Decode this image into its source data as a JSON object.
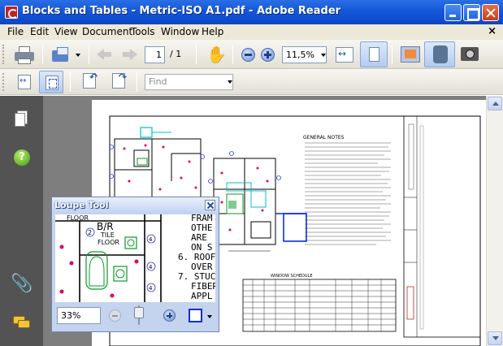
{
  "window": {
    "title": "Blocks and Tables - Metric-ISO A1.pdf - Adobe Reader"
  },
  "menu": {
    "items": [
      "File",
      "Edit",
      "View",
      "Document",
      "Tools",
      "Window",
      "Help"
    ],
    "close_doc": "×"
  },
  "toolbar": {
    "page_current": "1",
    "page_total": "/ 1",
    "zoom": "11,5%",
    "find_placeholder": "Find"
  },
  "document": {
    "notes_title": "GENERAL NOTES",
    "schedule_title": "WINDOW SCHEDULE",
    "room_label": "B/R",
    "tile_label": "TILE",
    "floor_label": "FLOOR"
  },
  "loupe": {
    "title": "Loupe Tool",
    "zoom": "33%",
    "zoom_level": 0.15,
    "rect_color": "#0b2ed8",
    "view_text": {
      "floor_a": "FLOOR",
      "room": "B/R",
      "tile": "TILE",
      "floor_b": "FLOOR",
      "num2": "2",
      "num4a": "4",
      "num4b": "4",
      "num4c": "4",
      "notes": [
        "FRAM",
        "OTHE",
        "ARE",
        "ON S",
        "6.  ROOF",
        "OVER",
        "7.  STUC",
        "FIBER",
        "APPL"
      ]
    }
  },
  "colors": {
    "title_bar": "#1457d8",
    "nav_pane": "#535353",
    "workspace": "#7e7e7e"
  }
}
